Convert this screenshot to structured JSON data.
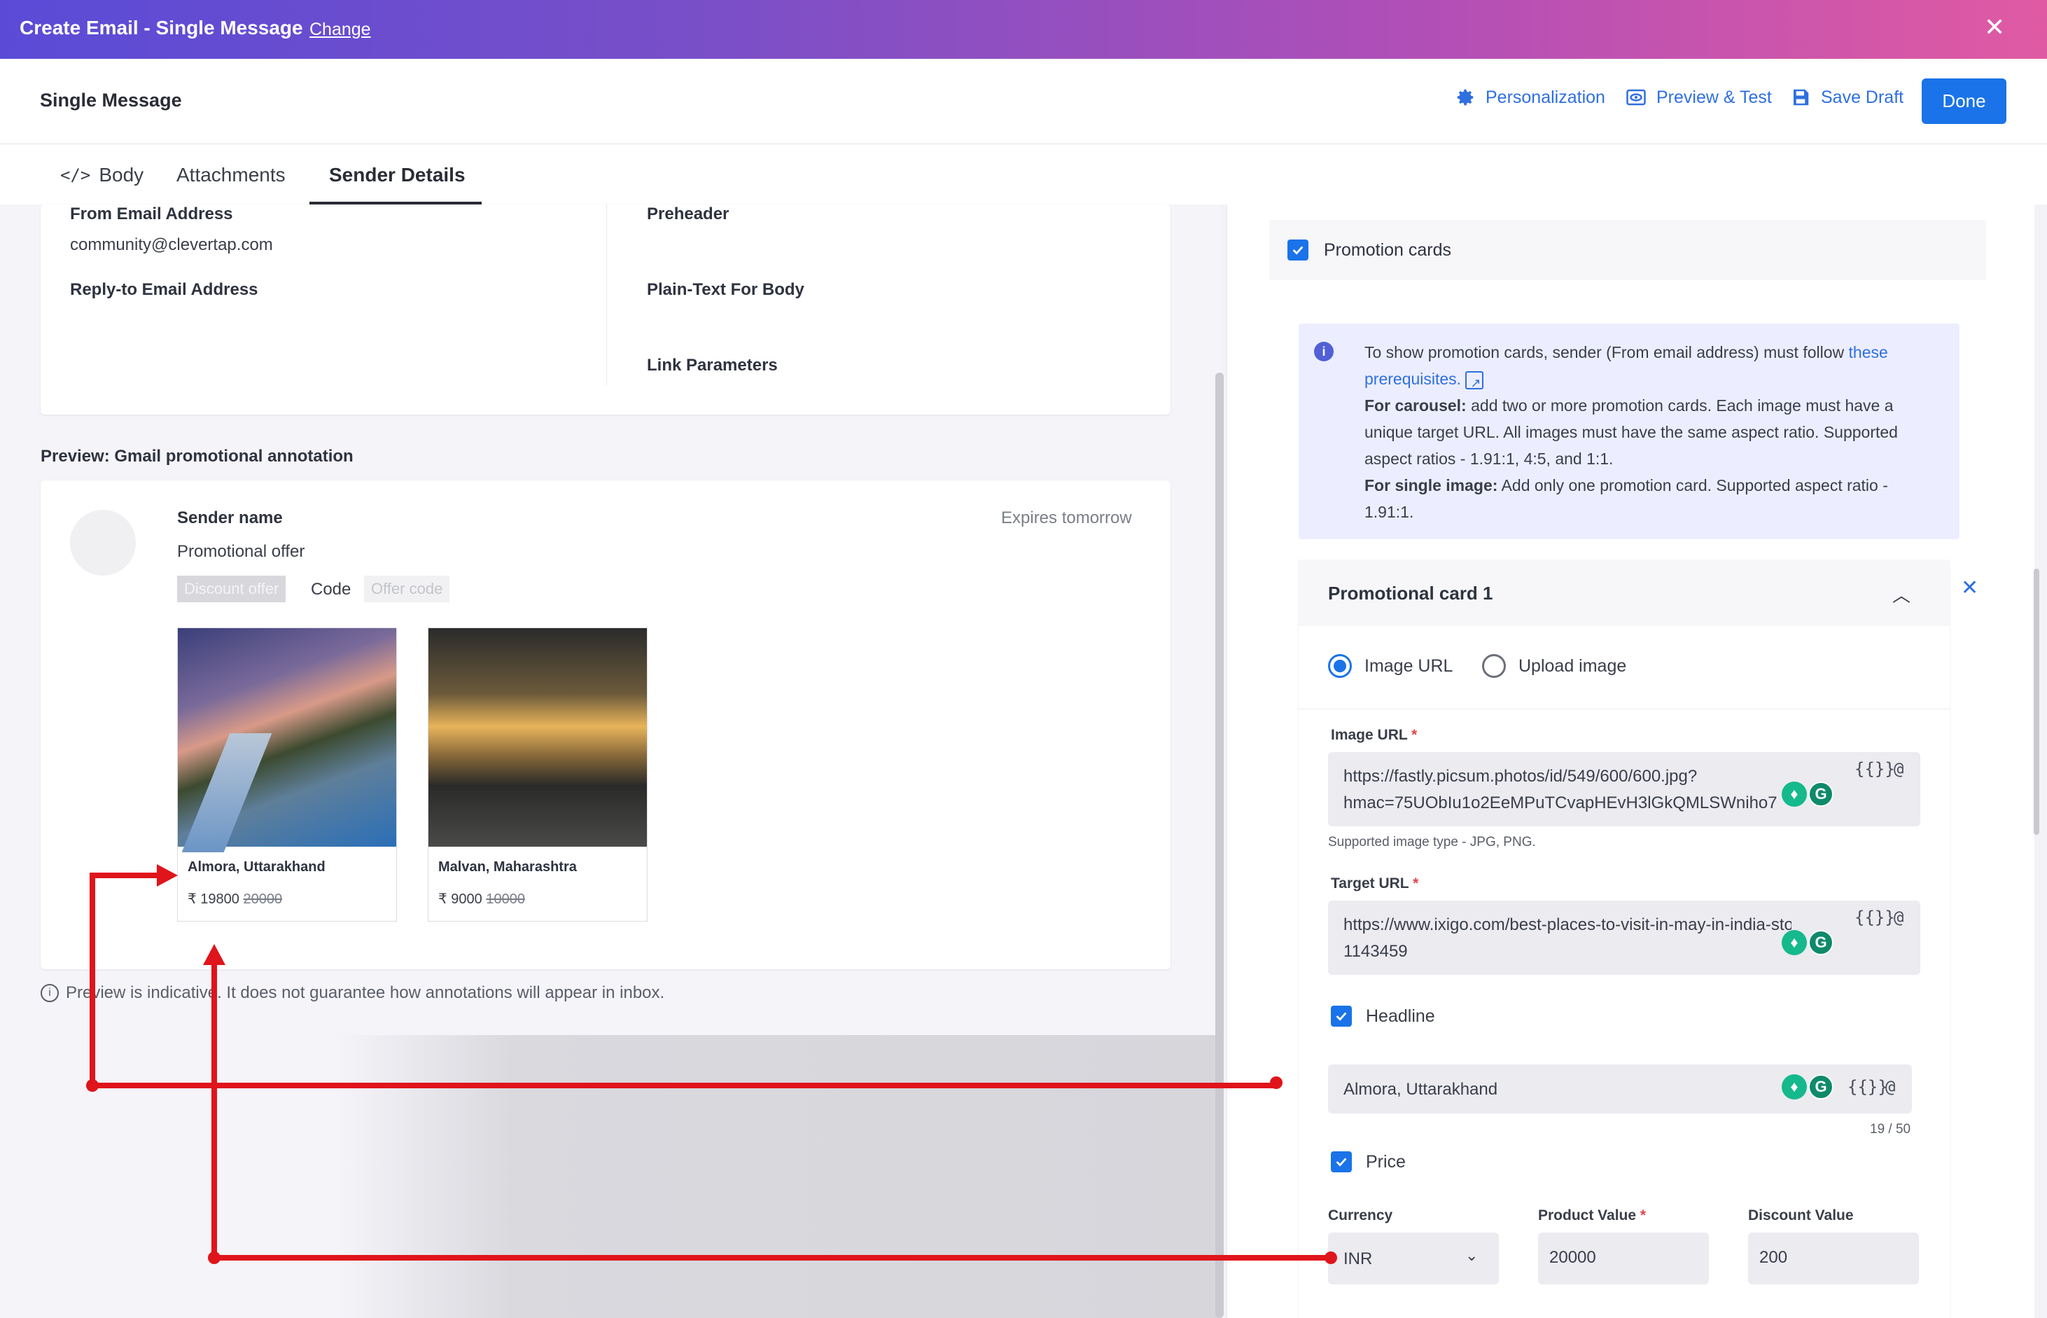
{
  "topbar": {
    "title": "Create Email - Single Message",
    "change": "Change",
    "close": "✕"
  },
  "header": {
    "title": "Single Message",
    "personalization": "Personalization",
    "preview_test": "Preview & Test",
    "save_draft": "Save Draft",
    "done": "Done"
  },
  "tabs": {
    "body": "Body",
    "attachments": "Attachments",
    "sender": "Sender Details"
  },
  "sender": {
    "from_label": "From Email Address",
    "from_value": "community@clevertap.com",
    "reply_label": "Reply-to Email Address",
    "preheader_label": "Preheader",
    "plaintext_label": "Plain-Text For Body",
    "link_label": "Link Parameters"
  },
  "preview": {
    "section_title": "Preview: Gmail promotional annotation",
    "sender_name": "Sender name",
    "expires": "Expires tomorrow",
    "promo_offer": "Promotional offer",
    "discount_chip": "Discount offer",
    "code_label": "Code",
    "offer_code_chip": "Offer code",
    "cards": [
      {
        "title": "Almora, Uttarakhand",
        "price": "₹ 19800",
        "old_price": "20000"
      },
      {
        "title": "Malvan, Maharashtra",
        "price": "₹ 9000",
        "old_price": "10000"
      }
    ],
    "note": "Preview is indicative. It does not guarantee how annotations will appear in inbox."
  },
  "right": {
    "promo_cards_label": "Promotion cards",
    "info": {
      "line1_pre": "To show promotion cards, sender (From email address) must follow ",
      "link": "these prerequisites.",
      "carousel_bold": "For carousel:",
      "carousel_text": " add two or more promotion cards. Each image must have a unique target URL. All images must have the same aspect ratio. Supported aspect ratios - 1.91:1, 4:5, and 1:1.",
      "single_bold": "For single image:",
      "single_text": " Add only one promotion card. Supported aspect ratio - 1.91:1."
    },
    "card_title": "Promotional card 1",
    "radio_image_url": "Image URL",
    "radio_upload": "Upload image",
    "image_url_label": "Image URL",
    "image_url_line1": "https://fastly.picsum.photos/id/549/600/600.jpg?",
    "image_url_line2": "hmac=75UObIu1o2EeMPuTCvapHEvH3lGkQMLSWniho7",
    "supported_types": "Supported image type - JPG, PNG.",
    "target_url_label": "Target URL",
    "target_url_line1": "https://www.ixigo.com/best-places-to-visit-in-may-in-india-story-",
    "target_url_line2": "1143459",
    "headline_label": "Headline",
    "headline_value": "Almora, Uttarakhand",
    "headline_count": "19 / 50",
    "price_label": "Price",
    "currency_label": "Currency",
    "currency_value": "INR",
    "product_value_label": "Product Value",
    "product_value": "20000",
    "discount_value_label": "Discount Value",
    "discount_value": "200",
    "token_braces": "{{}}",
    "token_at": "@",
    "required_mark": "*"
  },
  "colors": {
    "accent": "#1a73e8",
    "annotation": "#e0141b",
    "info_bg": "#eceeff"
  }
}
